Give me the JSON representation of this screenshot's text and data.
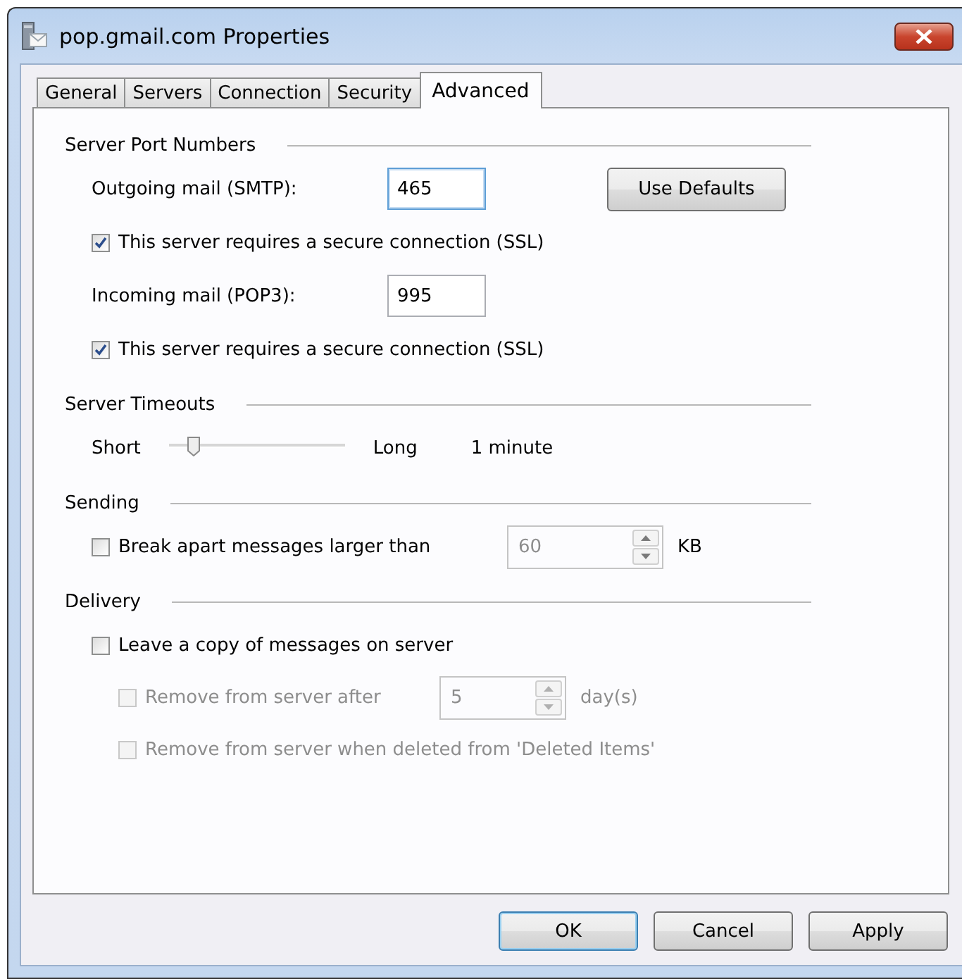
{
  "window": {
    "title": "pop.gmail.com Properties"
  },
  "tabs": [
    {
      "label": "General",
      "selected": false
    },
    {
      "label": "Servers",
      "selected": false
    },
    {
      "label": "Connection",
      "selected": false
    },
    {
      "label": "Security",
      "selected": false
    },
    {
      "label": "Advanced",
      "selected": true
    }
  ],
  "sections": [
    {
      "title": "Server Port Numbers",
      "rows": [
        {
          "kind": "port",
          "label": "Outgoing mail (SMTP):",
          "value": "465",
          "focused": true,
          "button": "Use Defaults"
        },
        {
          "kind": "check",
          "label": "This server requires a secure connection (SSL)",
          "checked": true,
          "disabled": false
        },
        {
          "kind": "port",
          "label": "Incoming mail (POP3):",
          "value": "995",
          "focused": false
        },
        {
          "kind": "check",
          "label": "This server requires a secure connection (SSL)",
          "checked": true,
          "disabled": false
        }
      ]
    },
    {
      "title": "Server Timeouts",
      "rows": [
        {
          "kind": "slider",
          "min_label": "Short",
          "max_label": "Long",
          "level": 0.14,
          "reading": "1 minute"
        }
      ]
    },
    {
      "title": "Sending",
      "rows": [
        {
          "kind": "check_spin",
          "label": "Break apart messages larger than",
          "checked": false,
          "disabled": false,
          "value": "60",
          "unit": "KB"
        }
      ]
    },
    {
      "title": "Delivery",
      "rows": [
        {
          "kind": "check",
          "label": "Leave a copy of messages on server",
          "checked": false,
          "disabled": false,
          "children": [
            {
              "kind": "check_spin",
              "label": "Remove from server after",
              "checked": false,
              "disabled": true,
              "value": "5",
              "unit": "day(s)"
            },
            {
              "kind": "check",
              "label": "Remove from server when deleted from 'Deleted Items'",
              "checked": false,
              "disabled": true
            }
          ]
        }
      ]
    }
  ],
  "buttons": [
    {
      "label": "OK",
      "default": true
    },
    {
      "label": "Cancel",
      "default": false
    },
    {
      "label": "Apply",
      "default": false
    }
  ]
}
